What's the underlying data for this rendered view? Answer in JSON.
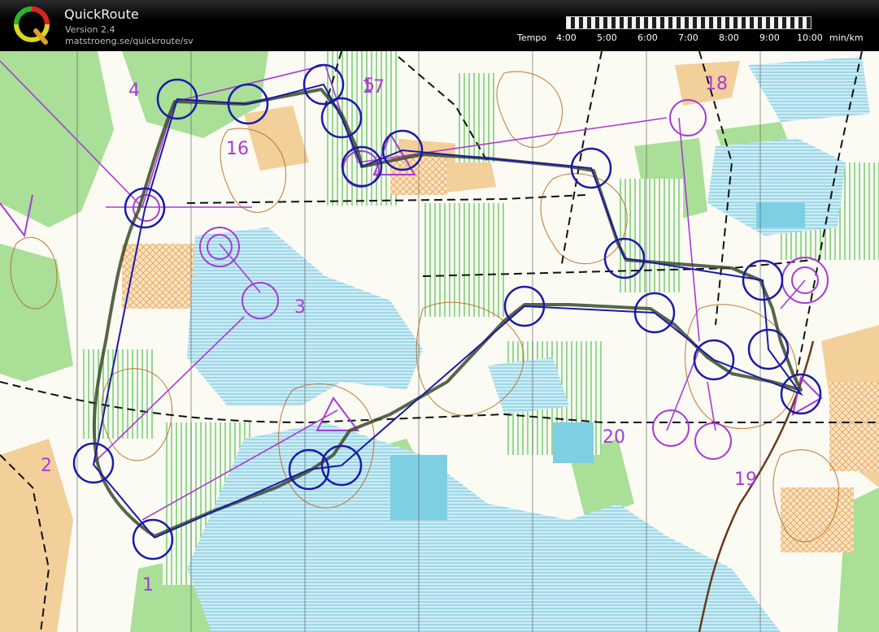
{
  "app": {
    "name": "QuickRoute",
    "version": "Version 2.4",
    "url": "matstroeng.se/quickroute/sv",
    "logo_letter": "Q"
  },
  "tempo": {
    "label": "Tempo",
    "ticks": [
      "4:00",
      "5:00",
      "6:00",
      "7:00",
      "8:00",
      "9:00",
      "10:00"
    ],
    "unit": "min/km"
  },
  "map": {
    "control_numbers": [
      "1",
      "2",
      "3",
      "4",
      "5",
      "16",
      "17",
      "18",
      "19",
      "20"
    ],
    "colors": {
      "course": "#a93ad6",
      "route_circles": "#1a1aa8",
      "route_track": "#3b4a2a",
      "open_land": "#f4d2a0",
      "forest_green": "#9fd98f",
      "water": "#8fd3e6",
      "contours": "#b5651d"
    }
  }
}
